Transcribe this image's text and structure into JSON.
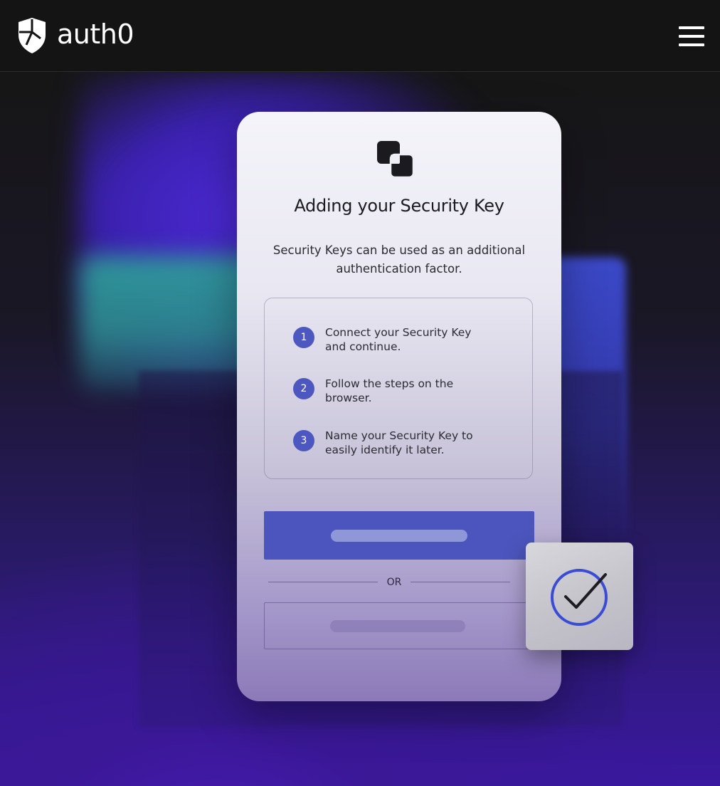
{
  "header": {
    "brand": "auth0",
    "logo_icon": "shield-logo-icon",
    "menu_icon": "hamburger-menu-icon"
  },
  "card": {
    "icon": "security-key-icon",
    "title": "Adding your Security Key",
    "description": "Security Keys can be used as an additional authentication factor.",
    "steps": [
      {
        "number": "1",
        "text": "Connect your Security Key\nand continue."
      },
      {
        "number": "2",
        "text": "Follow the steps on the\nbrowser."
      },
      {
        "number": "3",
        "text": "Name your Security Key to\neasily identify it later."
      }
    ],
    "divider_label": "OR"
  },
  "badge": {
    "icon": "checkmark-circle-icon"
  },
  "colors": {
    "accent": "#4c55bd",
    "header_bg": "#141414",
    "check_ring": "#3a4bd6"
  }
}
